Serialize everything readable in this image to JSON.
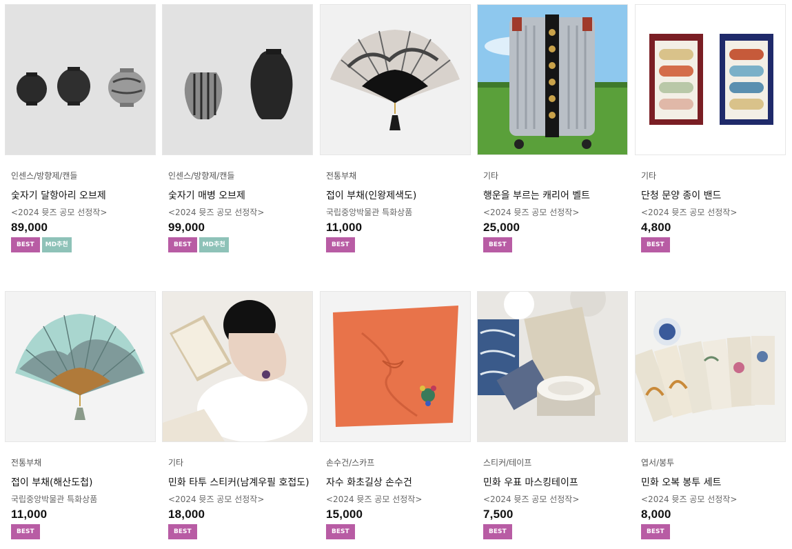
{
  "colors": {
    "best": "#b85ca4",
    "md": "#8ec2b8"
  },
  "products": [
    {
      "category": "인센스/방향제/캔들",
      "name": "숯자기 달항아리 오브제",
      "subtitle": "<2024 뮷즈 공모 선정작>",
      "price": "89,000",
      "badges": [
        "BEST",
        "MD추천"
      ],
      "image": "three-black-moon-jars"
    },
    {
      "category": "인센스/방향제/캔들",
      "name": "숯자기 매병 오브제",
      "subtitle": "<2024 뮷즈 공모 선정작>",
      "price": "99,000",
      "badges": [
        "BEST",
        "MD추천"
      ],
      "image": "two-black-maebyeong-vases"
    },
    {
      "category": "전통부채",
      "name": "접이 부채(인왕제색도)",
      "subtitle": "국립중앙박물관 특화상품",
      "price": "11,000",
      "badges": [
        "BEST"
      ],
      "image": "ink-landscape-folding-fan"
    },
    {
      "category": "기타",
      "name": "행운을 부르는 캐리어 벨트",
      "subtitle": "<2024 뮷즈 공모 선정작>",
      "price": "25,000",
      "badges": [
        "BEST"
      ],
      "image": "silver-suitcase-with-belt"
    },
    {
      "category": "기타",
      "name": "단청 문양 종이 밴드",
      "subtitle": "<2024 뮷즈 공모 선정작>",
      "price": "4,800",
      "badges": [
        "BEST"
      ],
      "image": "dancheong-bandage-boxes"
    },
    {
      "category": "전통부채",
      "name": "접이 부채(해산도첩)",
      "subtitle": "국립중앙박물관 특화상품",
      "price": "11,000",
      "badges": [
        "BEST"
      ],
      "image": "mint-landscape-folding-fan"
    },
    {
      "category": "기타",
      "name": "민화 타투 스티커(남계우필 호접도)",
      "subtitle": "<2024 뮷즈 공모 선정작>",
      "price": "18,000",
      "badges": [
        "BEST"
      ],
      "image": "woman-reading-tattoo"
    },
    {
      "category": "손수건/스카프",
      "name": "자수 화초길상 손수건",
      "subtitle": "<2024 뮷즈 공모 선정작>",
      "price": "15,000",
      "badges": [
        "BEST"
      ],
      "image": "orange-embroidered-handkerchief"
    },
    {
      "category": "스티커/테이프",
      "name": "민화 우표 마스킹테이프",
      "subtitle": "<2024 뮷즈 공모 선정작>",
      "price": "7,500",
      "badges": [
        "BEST"
      ],
      "image": "stamp-masking-tape"
    },
    {
      "category": "엽서/봉투",
      "name": "민화 오복 봉투 세트",
      "subtitle": "<2024 뮷즈 공모 선정작>",
      "price": "8,000",
      "badges": [
        "BEST"
      ],
      "image": "minhwa-envelope-set"
    }
  ]
}
